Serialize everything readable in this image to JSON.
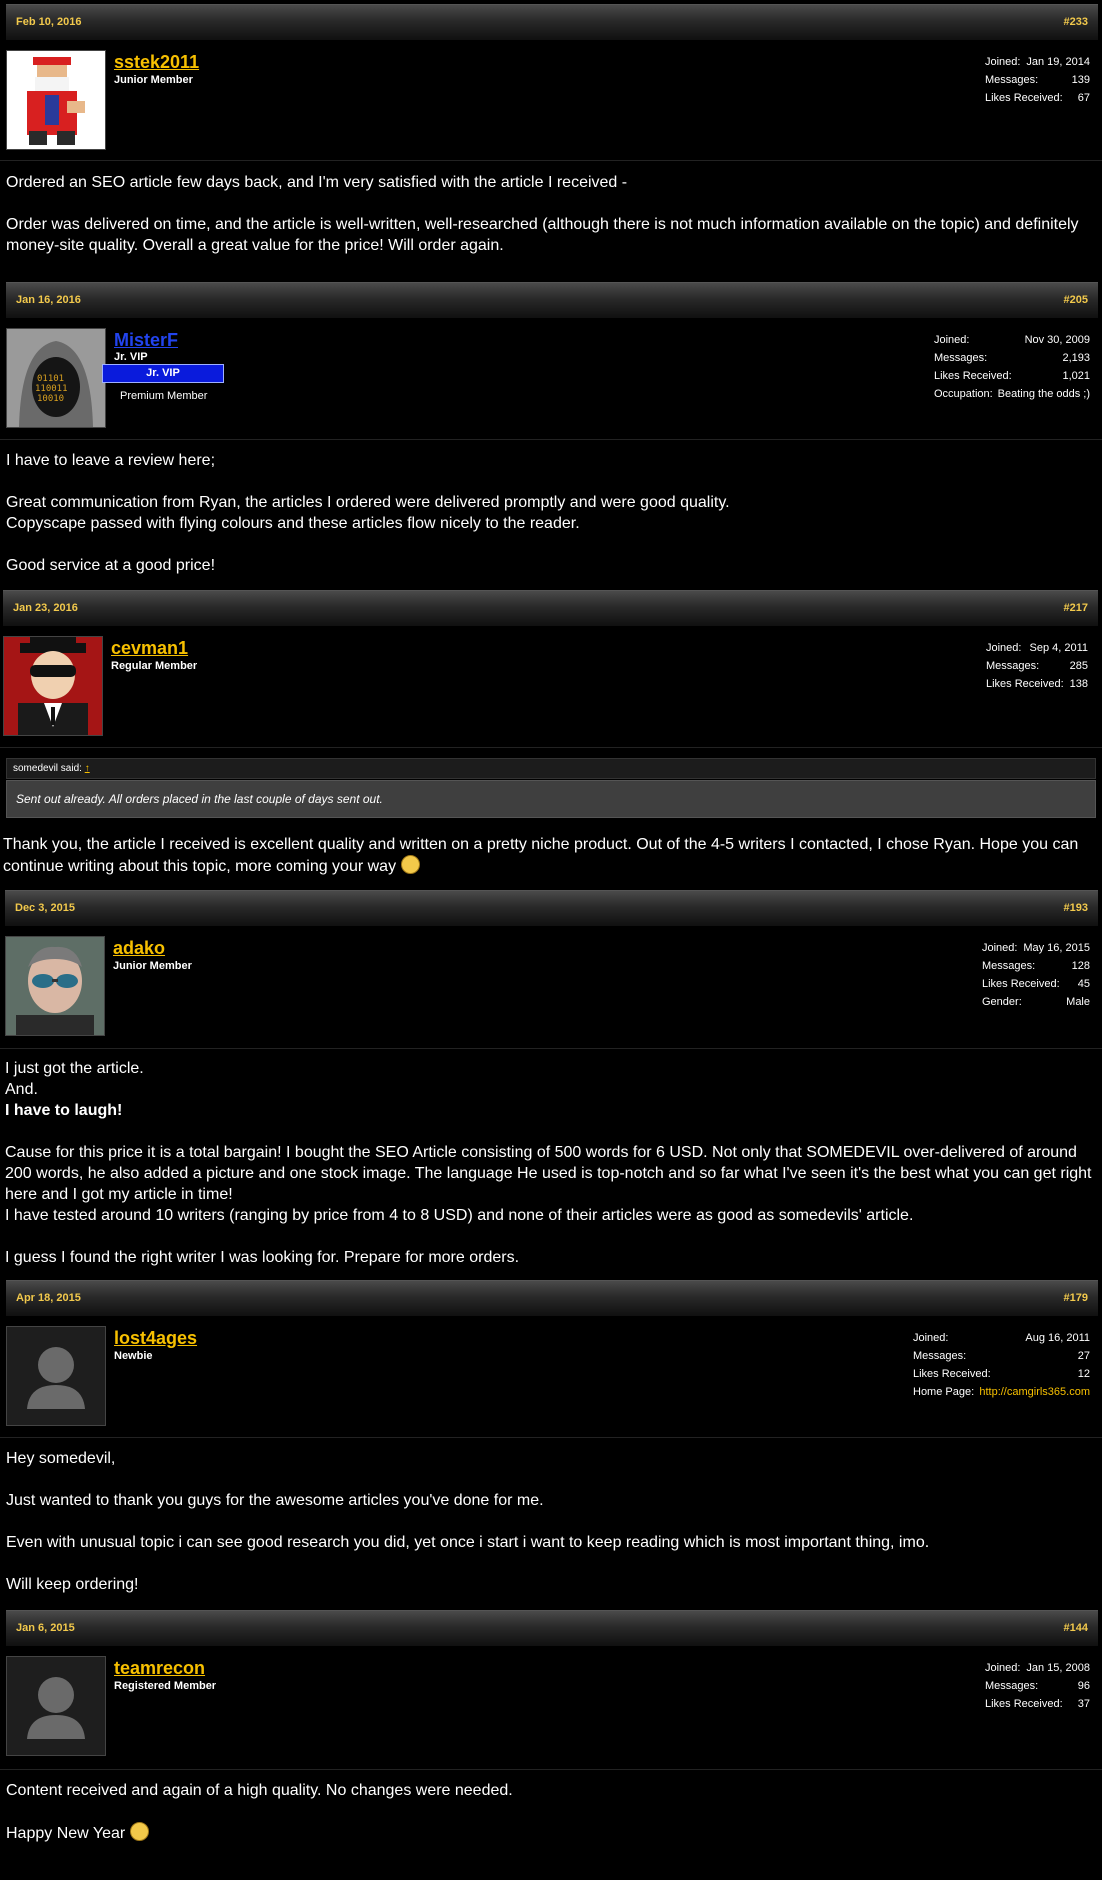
{
  "posts": [
    {
      "date": "Feb 10, 2016",
      "num": "#233",
      "user": "sstek2011",
      "title": "Junior Member",
      "stats": [
        [
          "Joined:",
          "Jan 19, 2014"
        ],
        [
          "Messages:",
          "139"
        ],
        [
          "Likes Received:",
          "67"
        ]
      ],
      "body": [
        "Ordered an SEO article few days back, and I'm very satisfied with the article I received -",
        "",
        "Order was delivered on time, and the article is well-written, well-researched (although there is not much information available on the topic) and definitely money-site quality. Overall a great value for the price! Will order again."
      ]
    },
    {
      "date": "Jan 16, 2016",
      "num": "#205",
      "user": "MisterF",
      "title": "Jr. VIP",
      "banner": "Jr. VIP",
      "extra": "Premium Member",
      "stats": [
        [
          "Joined:",
          "Nov 30, 2009"
        ],
        [
          "Messages:",
          "2,193"
        ],
        [
          "Likes Received:",
          "1,021"
        ],
        [
          "Occupation:",
          "Beating the odds ;)"
        ]
      ],
      "body": [
        "I have to leave a review here;",
        "",
        "Great communication from Ryan, the articles I ordered were delivered promptly and were good quality.",
        "Copyscape passed with flying colours and these articles flow nicely to the reader.",
        "",
        "Good service at a good price!"
      ]
    },
    {
      "date": "Jan 23, 2016",
      "num": "#217",
      "user": "cevman1",
      "title": "Regular Member",
      "stats": [
        [
          "Joined:",
          "Sep 4, 2011"
        ],
        [
          "Messages:",
          "285"
        ],
        [
          "Likes Received:",
          "138"
        ]
      ],
      "quote_author": "somedevil said:",
      "quote_arrow": "↑",
      "quote_text": "Sent out already. All orders placed in the last couple of days sent out.",
      "body": [
        "Thank you, the article I received is excellent quality and written on a pretty niche product. Out of the 4-5 writers I contacted, I chose Ryan. Hope you can continue writing about this topic, more coming your way"
      ]
    },
    {
      "date": "Dec 3, 2015",
      "num": "#193",
      "user": "adako",
      "title": "Junior Member",
      "stats": [
        [
          "Joined:",
          "May 16, 2015"
        ],
        [
          "Messages:",
          "128"
        ],
        [
          "Likes Received:",
          "45"
        ],
        [
          "Gender:",
          "Male"
        ]
      ],
      "body": [
        "I just got the article.",
        "And.",
        "I have to laugh!",
        "",
        "Cause for this price it is a total bargain! I bought the SEO Article consisting of 500 words for 6 USD. Not only that SOMEDEVIL over-delivered of around 200 words, he also added a picture and one stock image. The language He used is top-notch and so far what I've seen it's the best what you can get right here and I got my article in time!",
        "I have tested around 10 writers (ranging by price from 4 to 8 USD) and none of their articles were as good as somedevils' article.",
        "",
        "I guess I found the right writer I was looking for. Prepare for more orders."
      ]
    },
    {
      "date": "Apr 18, 2015",
      "num": "#179",
      "user": "lost4ages",
      "title": "Newbie",
      "stats": [
        [
          "Joined:",
          "Aug 16, 2011"
        ],
        [
          "Messages:",
          "27"
        ],
        [
          "Likes Received:",
          "12"
        ],
        [
          "Home Page:",
          "http://camgirls365.com"
        ]
      ],
      "body": [
        "Hey somedevil,",
        "",
        "Just wanted to thank you guys for the awesome articles you've done for me.",
        "",
        "Even with unusual topic i can see good research you did, yet once i start i want to keep reading which is most important thing, imo.",
        "",
        "Will keep ordering!"
      ]
    },
    {
      "date": "Jan 6, 2015",
      "num": "#144",
      "user": "teamrecon",
      "title": "Registered Member",
      "stats": [
        [
          "Joined:",
          "Jan 15, 2008"
        ],
        [
          "Messages:",
          "96"
        ],
        [
          "Likes Received:",
          "37"
        ]
      ],
      "body": [
        "Content received and again of a high quality. No changes were needed.",
        "",
        "Happy New Year"
      ]
    }
  ]
}
